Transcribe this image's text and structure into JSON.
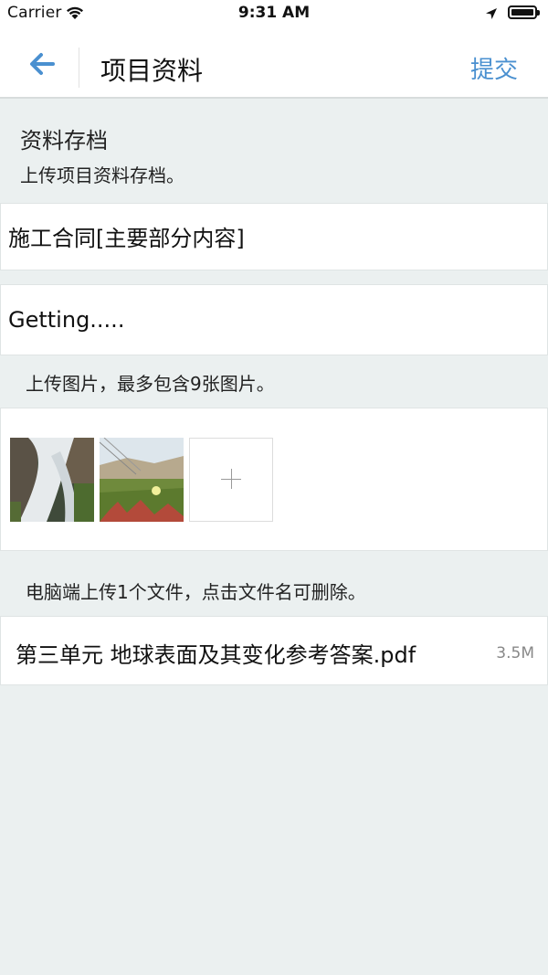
{
  "status_bar": {
    "carrier": "Carrier",
    "time": "9:31 AM",
    "icons": [
      "wifi-icon",
      "location-icon",
      "battery-icon"
    ]
  },
  "nav": {
    "back_icon": "arrow-left-icon",
    "title": "项目资料",
    "submit_label": "提交"
  },
  "section": {
    "title": "资料存档",
    "description": "上传项目资料存档。"
  },
  "contract_field": {
    "value": "施工合同[主要部分内容]"
  },
  "getting_field": {
    "value": "Getting....."
  },
  "images": {
    "hint": "上传图片，最多包含9张图片。",
    "thumbnails": [
      {
        "name": "waterfall-photo"
      },
      {
        "name": "field-flower-photo"
      }
    ],
    "add_icon": "plus-icon"
  },
  "file": {
    "hint": "电脑端上传1个文件，点击文件名可删除。",
    "name": "第三单元 地球表面及其变化参考答案.pdf",
    "size": "3.5M"
  },
  "colors": {
    "accent": "#4A90D0",
    "background": "#EBF0F0",
    "card": "#FFFFFF"
  }
}
